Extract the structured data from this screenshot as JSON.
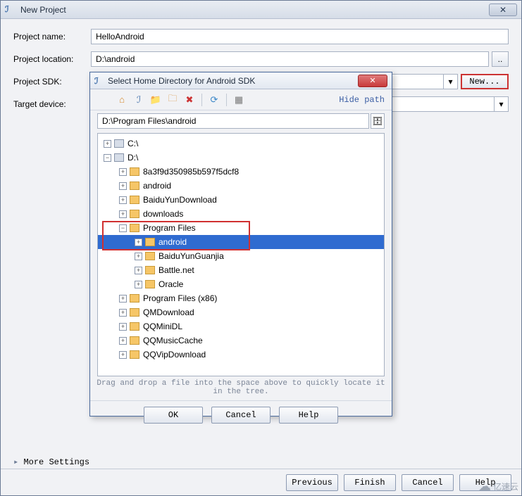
{
  "mainWindow": {
    "title": "New Project",
    "closeGlyph": "✕"
  },
  "form": {
    "projectNameLabel": "Project name:",
    "projectNameValue": "HelloAndroid",
    "projectLocationLabel": "Project location:",
    "projectLocationValue": "D:\\android",
    "dotsLabel": "..",
    "projectSDKLabel": "Project SDK:",
    "newBtnLabel": "New...",
    "targetDeviceLabel": "Target device:"
  },
  "moreSettingsLabel": "More Settings",
  "bottomButtons": {
    "previous": "Previous",
    "finish": "Finish",
    "cancel": "Cancel",
    "help": "Help"
  },
  "watermark": "亿速云",
  "modal": {
    "title": "Select Home Directory for Android SDK",
    "closeGlyph": "✕",
    "hidePath": "Hide path",
    "pathValue": "D:\\Program Files\\android",
    "hint": "Drag and drop a file into the space above to quickly locate it in the tree.",
    "buttons": {
      "ok": "OK",
      "cancel": "Cancel",
      "help": "Help"
    }
  },
  "toolbarIcons": {
    "home": "⌂",
    "project": "ℐ",
    "newFolder": "📁",
    "delete": "✖",
    "refresh": "⟳",
    "showHidden": "▦"
  },
  "tree": [
    {
      "depth": 0,
      "icon": "disk",
      "label": "C:\\",
      "expander": "+"
    },
    {
      "depth": 0,
      "icon": "disk",
      "label": "D:\\",
      "expander": "−"
    },
    {
      "depth": 1,
      "icon": "folder",
      "label": "8a3f9d350985b597f5dcf8",
      "expander": "+"
    },
    {
      "depth": 1,
      "icon": "folder",
      "label": "android",
      "expander": "+"
    },
    {
      "depth": 1,
      "icon": "folder",
      "label": "BaiduYunDownload",
      "expander": "+"
    },
    {
      "depth": 1,
      "icon": "folder",
      "label": "downloads",
      "expander": "+"
    },
    {
      "depth": 1,
      "icon": "folder",
      "label": "Program Files",
      "expander": "−",
      "redBoxStart": true
    },
    {
      "depth": 2,
      "icon": "folder",
      "label": "android",
      "expander": "+",
      "selected": true,
      "redBoxEnd": true
    },
    {
      "depth": 2,
      "icon": "folder",
      "label": "BaiduYunGuanjia",
      "expander": "+"
    },
    {
      "depth": 2,
      "icon": "folder",
      "label": "Battle.net",
      "expander": "+"
    },
    {
      "depth": 2,
      "icon": "folder",
      "label": "Oracle",
      "expander": "+"
    },
    {
      "depth": 1,
      "icon": "folder",
      "label": "Program Files (x86)",
      "expander": "+"
    },
    {
      "depth": 1,
      "icon": "folder",
      "label": "QMDownload",
      "expander": "+"
    },
    {
      "depth": 1,
      "icon": "folder",
      "label": "QQMiniDL",
      "expander": "+"
    },
    {
      "depth": 1,
      "icon": "folder",
      "label": "QQMusicCache",
      "expander": "+"
    },
    {
      "depth": 1,
      "icon": "folder",
      "label": "QQVipDownload",
      "expander": "+"
    }
  ]
}
